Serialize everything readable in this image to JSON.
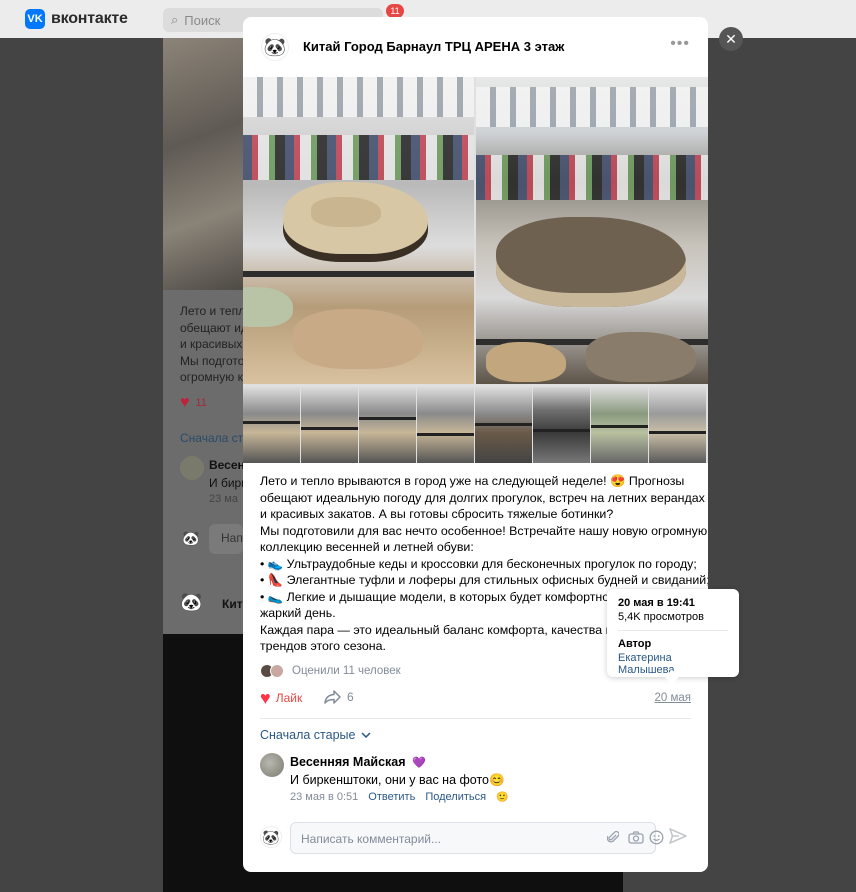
{
  "app": {
    "logo_text": "вконтакте",
    "logo_mark": "VK",
    "search_placeholder": "Поиск",
    "notifications_count": "11"
  },
  "background": {
    "text_lines": [
      "Лето и тепл",
      "обещают ид",
      "и красивых",
      "Мы подгото",
      "огромную к"
    ],
    "likes": "11",
    "sort": "Сначала ст",
    "comment_author": "Весен",
    "comment_text": "И бирк",
    "comment_date": "23 ма",
    "input_text": "Нап",
    "author_name": "Кит"
  },
  "post": {
    "group_name": "Китай Город Барнаул ТРЦ АРЕНА 3 этаж",
    "more_label": "•••",
    "text_lines": [
      "Лето и тепло врываются в город уже на следующей неделе! 😍 Прогнозы",
      "обещают идеальную погоду для долгих прогулок, встреч на летних верандах",
      "и красивых закатов. А вы готовы сбросить тяжелые ботинки?",
      "Мы подготовили для вас нечто особенное! Встречайте нашу новую огромную",
      "коллекцию весенней и летней обуви:",
      "• 👟 Ультраудобные кеды и кроссовки для бесконечных прогулок по городу;",
      "• 👠 Элегантные туфли и лоферы для стильных офисных будней и свиданий;",
      "• 🥿 Легкие и дышащие модели, в которых будет комфортно да",
      "жаркий день.",
      "Каждая пара — это идеальный баланс комфорта, качества и ак",
      "трендов этого сезона."
    ],
    "rated_text": "Оценили 11 человек",
    "like_label": "Лайк",
    "share_count": "6",
    "date": "20 мая"
  },
  "comments": {
    "sort_label": "Сначала старые",
    "items": [
      {
        "author": "Весенняя Майская",
        "text": "И биркенштоки, они у вас на фото😊",
        "date": "23 мая в 0:51",
        "reply": "Ответить",
        "share": "Поделиться"
      }
    ],
    "input_placeholder": "Написать комментарий..."
  },
  "tooltip": {
    "time": "20 мая в 19:41",
    "views": "5,4K просмотров",
    "author_label": "Автор",
    "author_name": "Екатерина Малышева"
  },
  "icons": {
    "close": "close-icon",
    "heart": "heart-icon",
    "share": "share-icon",
    "attach": "paperclip-icon",
    "camera": "camera-icon",
    "emoji": "smile-icon",
    "send": "send-icon",
    "chevron": "chevron-down-icon"
  },
  "colors": {
    "accent_link": "#2a5885",
    "like_red": "#e64646",
    "muted": "#818c99",
    "vk_blue": "#0077ff"
  }
}
